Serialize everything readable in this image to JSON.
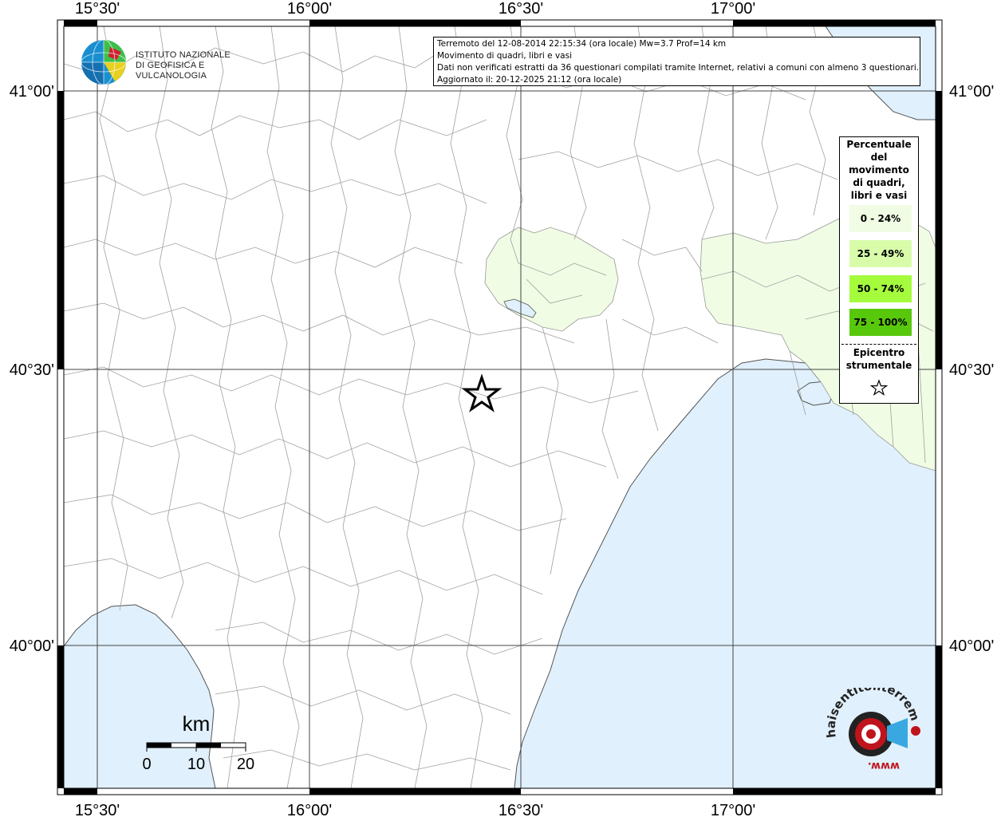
{
  "info": {
    "line1": "Terremoto del 12-08-2014 22:15:34 (ora locale) Mw=3.7 Prof=14 km",
    "line2": "Movimento di quadri, libri e vasi",
    "line3": "Dati non verificati estratti da 36 questionari compilati tramite Internet, relativi a comuni con almeno 3 questionari.",
    "line4": "Aggiornato il: 20-12-2025 21:12 (ora locale)"
  },
  "logo_ingv": {
    "line1": "ISTITUTO NAZIONALE",
    "line2": "DI GEOFISICA E VULCANOLOGIA"
  },
  "axes": {
    "top_labels": [
      "15°30'",
      "16°00'",
      "16°30'",
      "17°00'"
    ],
    "bottom_labels": [
      "15°30'",
      "16°00'",
      "16°30'",
      "17°00'"
    ],
    "left_labels": [
      "41°00'",
      "40°30'",
      "40°00'"
    ],
    "right_labels": [
      "41°00'",
      "40°30'",
      "40°00'"
    ]
  },
  "legend": {
    "title": [
      "Percentuale",
      "del",
      "movimento",
      "di quadri,",
      "libri e vasi"
    ],
    "items": [
      {
        "label": "0 - 24%",
        "color": "#f0fce4"
      },
      {
        "label": "25 - 49%",
        "color": "#d8fcaa"
      },
      {
        "label": "50 - 74%",
        "color": "#a4fc3c"
      },
      {
        "label": "75 - 100%",
        "color": "#58c80c"
      }
    ],
    "epicenter_title": [
      "Epicentro",
      "strumentale"
    ]
  },
  "scale_bar": {
    "unit": "km",
    "ticks": [
      "0",
      "10",
      "20"
    ]
  },
  "logo_hsl": {
    "text": "haisentitoilterremoto.it",
    "url_text": "www."
  },
  "colors": {
    "sea": "#e0f0fc",
    "land": "#ffffff",
    "felt_light": "#f0fce4",
    "felt_medium": "#d8fcaa",
    "borders": "#999999",
    "grid": "#444444"
  },
  "map_features": {
    "epicenter_icon": "star-icon"
  }
}
